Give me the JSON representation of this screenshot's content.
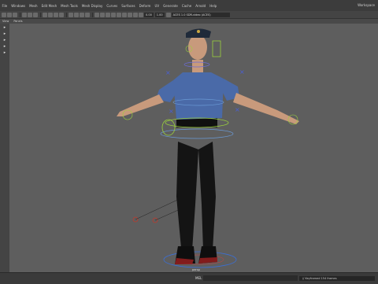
{
  "menu": {
    "items": [
      "File",
      "Windows",
      "Mesh",
      "Edit Mesh",
      "Mesh Tools",
      "Mesh Display",
      "Curves",
      "Surfaces",
      "Deform",
      "UV",
      "Generate",
      "Cache",
      "Arnold",
      "Help"
    ],
    "workspace": "Workspace"
  },
  "statusline": {
    "field1": "0.00",
    "field2": "1.00",
    "color_space": "ACES 1.0 SDR-video (ACES)"
  },
  "panel_menu": {
    "items": [
      "View",
      "Panels"
    ]
  },
  "toolbox": {
    "items": [
      "▸",
      "▸",
      "▸",
      "▸",
      "▸"
    ]
  },
  "viewport": {
    "camera_label": "persp"
  },
  "command_line": {
    "label": "MEL",
    "result": "// Keyframed 154 frames"
  },
  "colors": {
    "uniform_blue": "#4a6aa8",
    "trousers": "#141414",
    "control_green": "#9bd13c",
    "control_purple": "#6b6bd6",
    "ik_red": "#c0392b"
  }
}
